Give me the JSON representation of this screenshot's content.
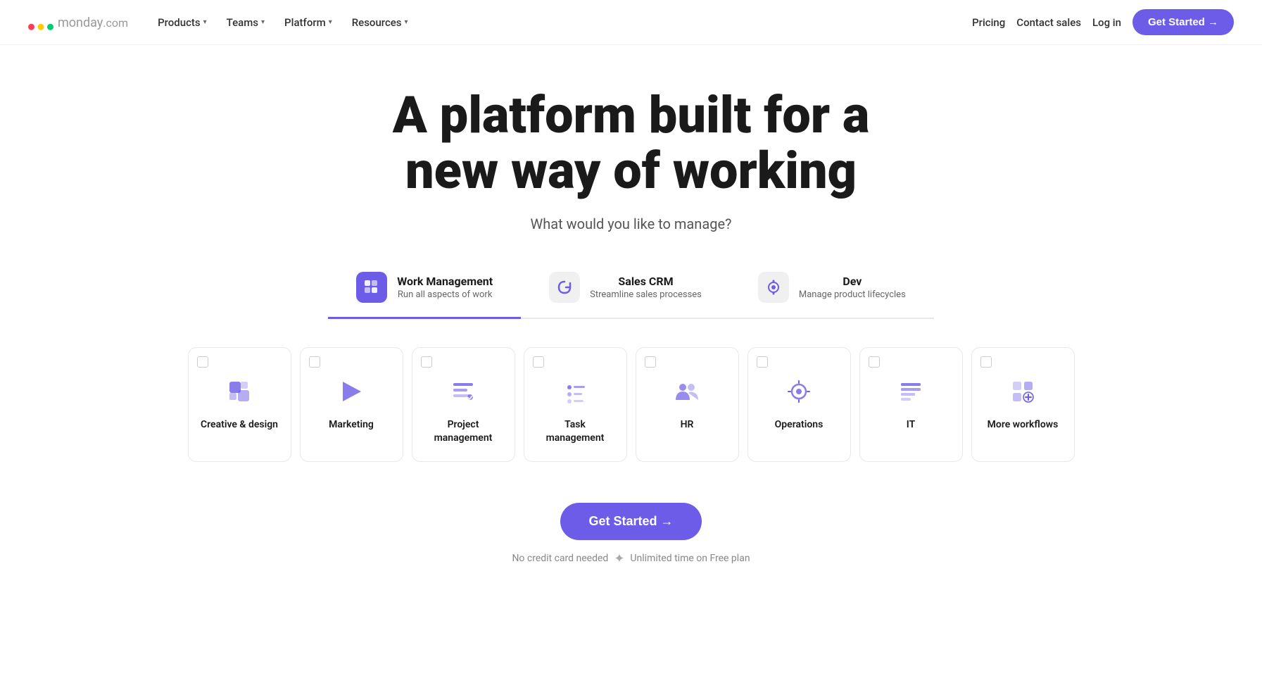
{
  "logo": {
    "text": "monday",
    "suffix": ".com"
  },
  "nav": {
    "links": [
      {
        "label": "Products",
        "hasChevron": true
      },
      {
        "label": "Teams",
        "hasChevron": true
      },
      {
        "label": "Platform",
        "hasChevron": true
      },
      {
        "label": "Resources",
        "hasChevron": true
      }
    ],
    "right": [
      {
        "label": "Pricing"
      },
      {
        "label": "Contact sales"
      },
      {
        "label": "Log in"
      }
    ],
    "cta": "Get Started →"
  },
  "hero": {
    "title_line1": "A platform built for a",
    "title_line2": "new way of working",
    "subtitle": "What would you like to manage?"
  },
  "product_tabs": [
    {
      "key": "work",
      "icon": "⬡",
      "icon_style": "purple",
      "label": "Work Management",
      "desc": "Run all aspects of work",
      "active": true
    },
    {
      "key": "crm",
      "icon": "↺",
      "icon_style": "gray",
      "label": "Sales CRM",
      "desc": "Streamline sales processes",
      "active": false
    },
    {
      "key": "dev",
      "icon": "◉",
      "icon_style": "gray",
      "label": "Dev",
      "desc": "Manage product lifecycles",
      "active": false
    }
  ],
  "workflow_cards": [
    {
      "id": "creative",
      "label": "Creative & design",
      "icon": "creative"
    },
    {
      "id": "marketing",
      "label": "Marketing",
      "icon": "marketing"
    },
    {
      "id": "project",
      "label": "Project management",
      "icon": "project"
    },
    {
      "id": "task",
      "label": "Task management",
      "icon": "task"
    },
    {
      "id": "hr",
      "label": "HR",
      "icon": "hr"
    },
    {
      "id": "operations",
      "label": "Operations",
      "icon": "operations"
    },
    {
      "id": "it",
      "label": "IT",
      "icon": "it"
    },
    {
      "id": "more",
      "label": "More workflows",
      "icon": "more"
    }
  ],
  "cta": {
    "button": "Get Started →",
    "note1": "No credit card needed",
    "separator": "✦",
    "note2": "Unlimited time on Free plan"
  }
}
